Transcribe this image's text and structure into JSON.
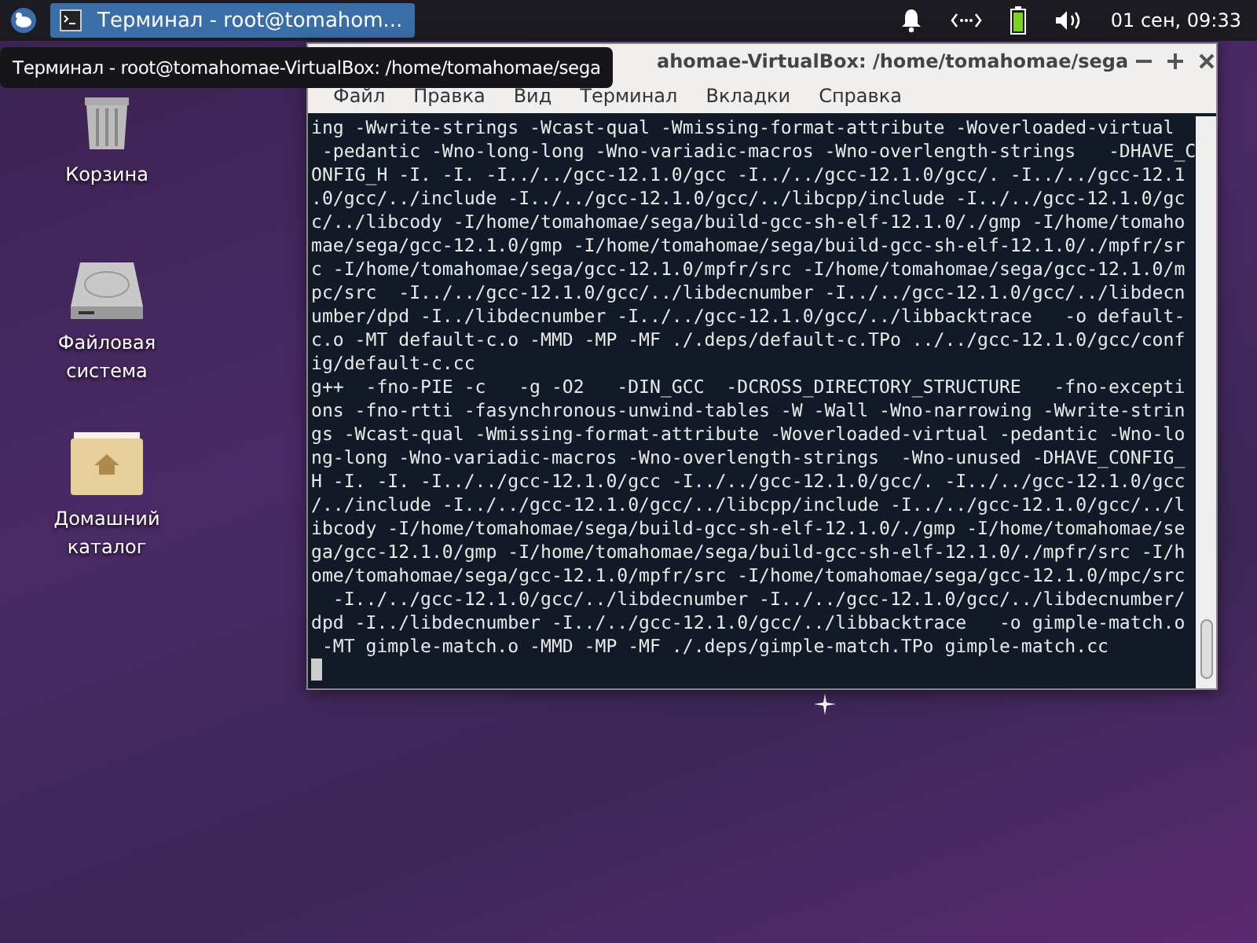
{
  "panel": {
    "tasks": [
      {
        "label": "Терминал - root@tomahom...",
        "selected": true
      }
    ],
    "clock": "01 сен, 09:33"
  },
  "tooltip": "Терминал - root@tomahomae-VirtualBox: /home/tomahomae/sega",
  "desktop_icons": [
    {
      "kind": "trash",
      "label": "Корзина"
    },
    {
      "kind": "drive",
      "label": "Файловая система"
    },
    {
      "kind": "home",
      "label": "Домашний каталог"
    }
  ],
  "window": {
    "title": "ahomae-VirtualBox: /home/tomahomae/sega",
    "menu": [
      "Файл",
      "Правка",
      "Вид",
      "Терминал",
      "Вкладки",
      "Справка"
    ],
    "lines": [
      "ing -Wwrite-strings -Wcast-qual -Wmissing-format-attribute -Woverloaded-virtual",
      " -pedantic -Wno-long-long -Wno-variadic-macros -Wno-overlength-strings   -DHAVE_C",
      "ONFIG_H -I. -I. -I../../gcc-12.1.0/gcc -I../../gcc-12.1.0/gcc/. -I../../gcc-12.1",
      ".0/gcc/../include -I../../gcc-12.1.0/gcc/../libcpp/include -I../../gcc-12.1.0/gc",
      "c/../libcody -I/home/tomahomae/sega/build-gcc-sh-elf-12.1.0/./gmp -I/home/tomaho",
      "mae/sega/gcc-12.1.0/gmp -I/home/tomahomae/sega/build-gcc-sh-elf-12.1.0/./mpfr/sr",
      "c -I/home/tomahomae/sega/gcc-12.1.0/mpfr/src -I/home/tomahomae/sega/gcc-12.1.0/m",
      "pc/src  -I../../gcc-12.1.0/gcc/../libdecnumber -I../../gcc-12.1.0/gcc/../libdecn",
      "umber/dpd -I../libdecnumber -I../../gcc-12.1.0/gcc/../libbacktrace   -o default-",
      "c.o -MT default-c.o -MMD -MP -MF ./.deps/default-c.TPo ../../gcc-12.1.0/gcc/conf",
      "ig/default-c.cc",
      "g++  -fno-PIE -c   -g -O2   -DIN_GCC  -DCROSS_DIRECTORY_STRUCTURE   -fno-excepti",
      "ons -fno-rtti -fasynchronous-unwind-tables -W -Wall -Wno-narrowing -Wwrite-strin",
      "gs -Wcast-qual -Wmissing-format-attribute -Woverloaded-virtual -pedantic -Wno-lo",
      "ng-long -Wno-variadic-macros -Wno-overlength-strings  -Wno-unused -DHAVE_CONFIG_",
      "H -I. -I. -I../../gcc-12.1.0/gcc -I../../gcc-12.1.0/gcc/. -I../../gcc-12.1.0/gcc",
      "/../include -I../../gcc-12.1.0/gcc/../libcpp/include -I../../gcc-12.1.0/gcc/../l",
      "ibcody -I/home/tomahomae/sega/build-gcc-sh-elf-12.1.0/./gmp -I/home/tomahomae/se",
      "ga/gcc-12.1.0/gmp -I/home/tomahomae/sega/build-gcc-sh-elf-12.1.0/./mpfr/src -I/h",
      "ome/tomahomae/sega/gcc-12.1.0/mpfr/src -I/home/tomahomae/sega/gcc-12.1.0/mpc/src",
      "  -I../../gcc-12.1.0/gcc/../libdecnumber -I../../gcc-12.1.0/gcc/../libdecnumber/",
      "dpd -I../libdecnumber -I../../gcc-12.1.0/gcc/../libbacktrace   -o gimple-match.o",
      " -MT gimple-match.o -MMD -MP -MF ./.deps/gimple-match.TPo gimple-match.cc"
    ]
  }
}
